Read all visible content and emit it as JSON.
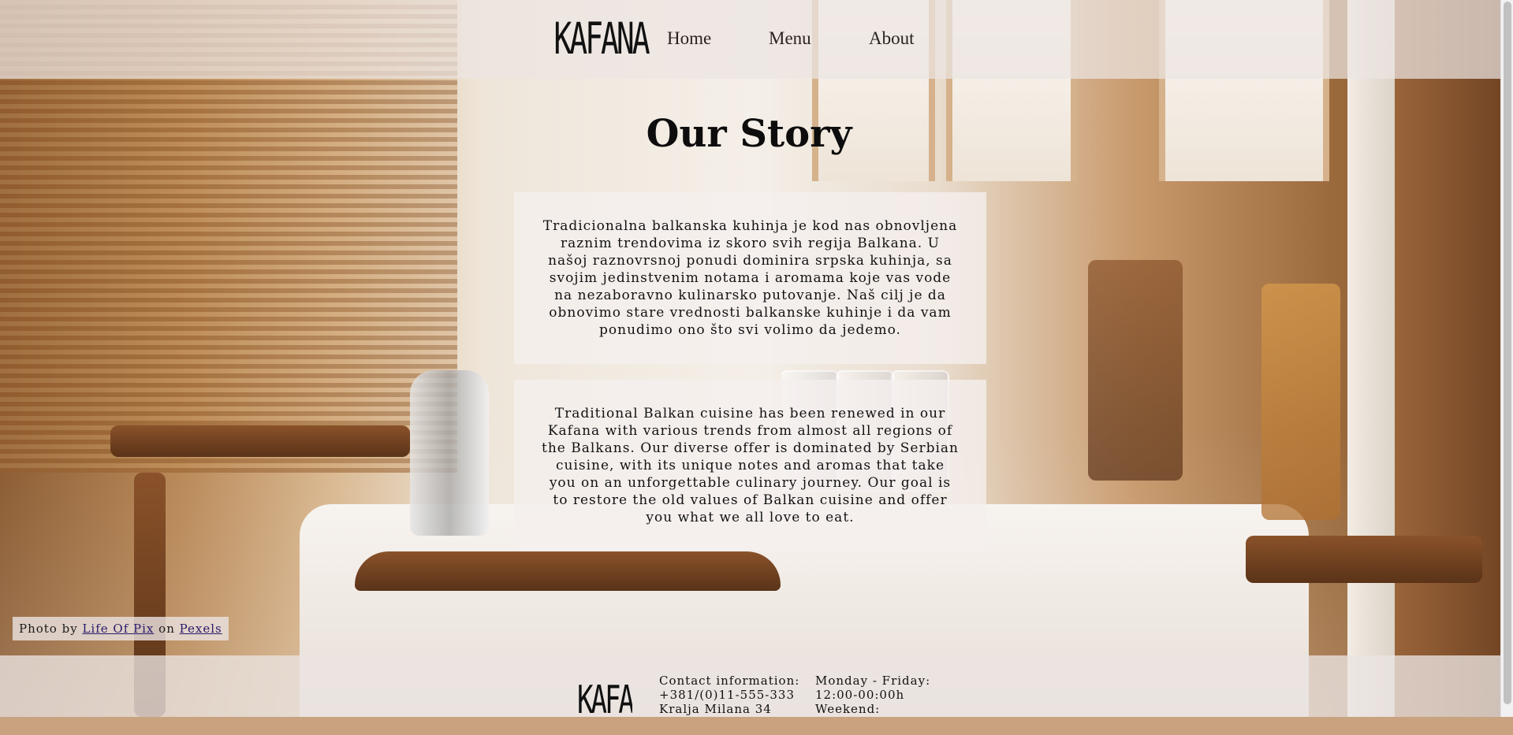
{
  "brand": {
    "logo_text": "KAFANA"
  },
  "nav": [
    {
      "label": "Home"
    },
    {
      "label": "Menu"
    },
    {
      "label": "About"
    }
  ],
  "main": {
    "title": "Our Story",
    "story_serbian": "Tradicionalna balkanska kuhinja je kod nas obnovljena raznim trendovima iz skoro svih regija Balkana. U našoj raznovrsnoj ponudi dominira srpska kuhinja, sa svojim jedinstvenim notama i aromama koje vas vode na nezaboravno kulinarsko putovanje. Naš cilj je da obnovimo stare vrednosti balkanske kuhinje i da vam ponudimo ono što svi volimo da jedemo.",
    "story_english": "Traditional Balkan cuisine has been renewed in our Kafana with various trends from almost all regions of the Balkans. Our diverse offer is dominated by Serbian cuisine, with its unique notes and aromas that take you on an unforgettable culinary journey. Our goal is to restore the old values of Balkan cuisine and offer you what we all love to eat."
  },
  "credit": {
    "prefix": "Photo by ",
    "author": "Life Of Pix",
    "middle": " on ",
    "source": "Pexels"
  },
  "footer": {
    "logo_text": "KAFANA",
    "contact_heading": "Contact information:",
    "phone": "+381/(0)11-555-333",
    "address": "Kralja Milana 34",
    "hours_weekdays": "Monday - Friday:",
    "hours_weekdays_time": "12:00-00:00h",
    "hours_weekend": "Weekend:"
  }
}
